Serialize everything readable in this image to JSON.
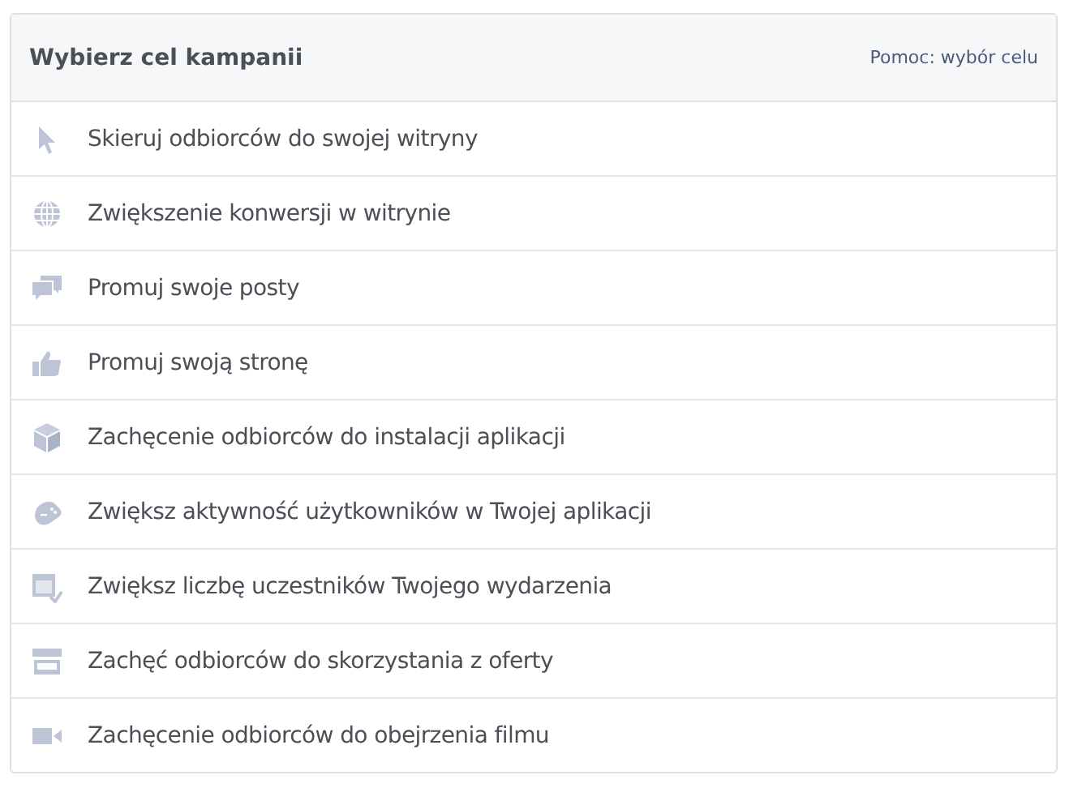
{
  "header": {
    "title": "Wybierz cel kampanii",
    "help_link": "Pomoc: wybór celu"
  },
  "objectives": [
    {
      "kind": "cursor",
      "label": "Skieruj odbiorców do swojej witryny"
    },
    {
      "kind": "globe",
      "label": "Zwiększenie konwersji w witrynie"
    },
    {
      "kind": "chat",
      "label": "Promuj swoje posty"
    },
    {
      "kind": "like",
      "label": "Promuj swoją stronę"
    },
    {
      "kind": "box",
      "label": "Zachęcenie odbiorców do instalacji aplikacji"
    },
    {
      "kind": "gamepad",
      "label": "Zwiększ aktywność użytkowników w Twojej aplikacji"
    },
    {
      "kind": "calendar",
      "label": "Zwiększ liczbę uczestników Twojego wydarzenia"
    },
    {
      "kind": "store",
      "label": "Zachęć odbiorców do skorzystania z oferty"
    },
    {
      "kind": "video",
      "label": "Zachęcenie odbiorców do obejrzenia filmu"
    }
  ]
}
